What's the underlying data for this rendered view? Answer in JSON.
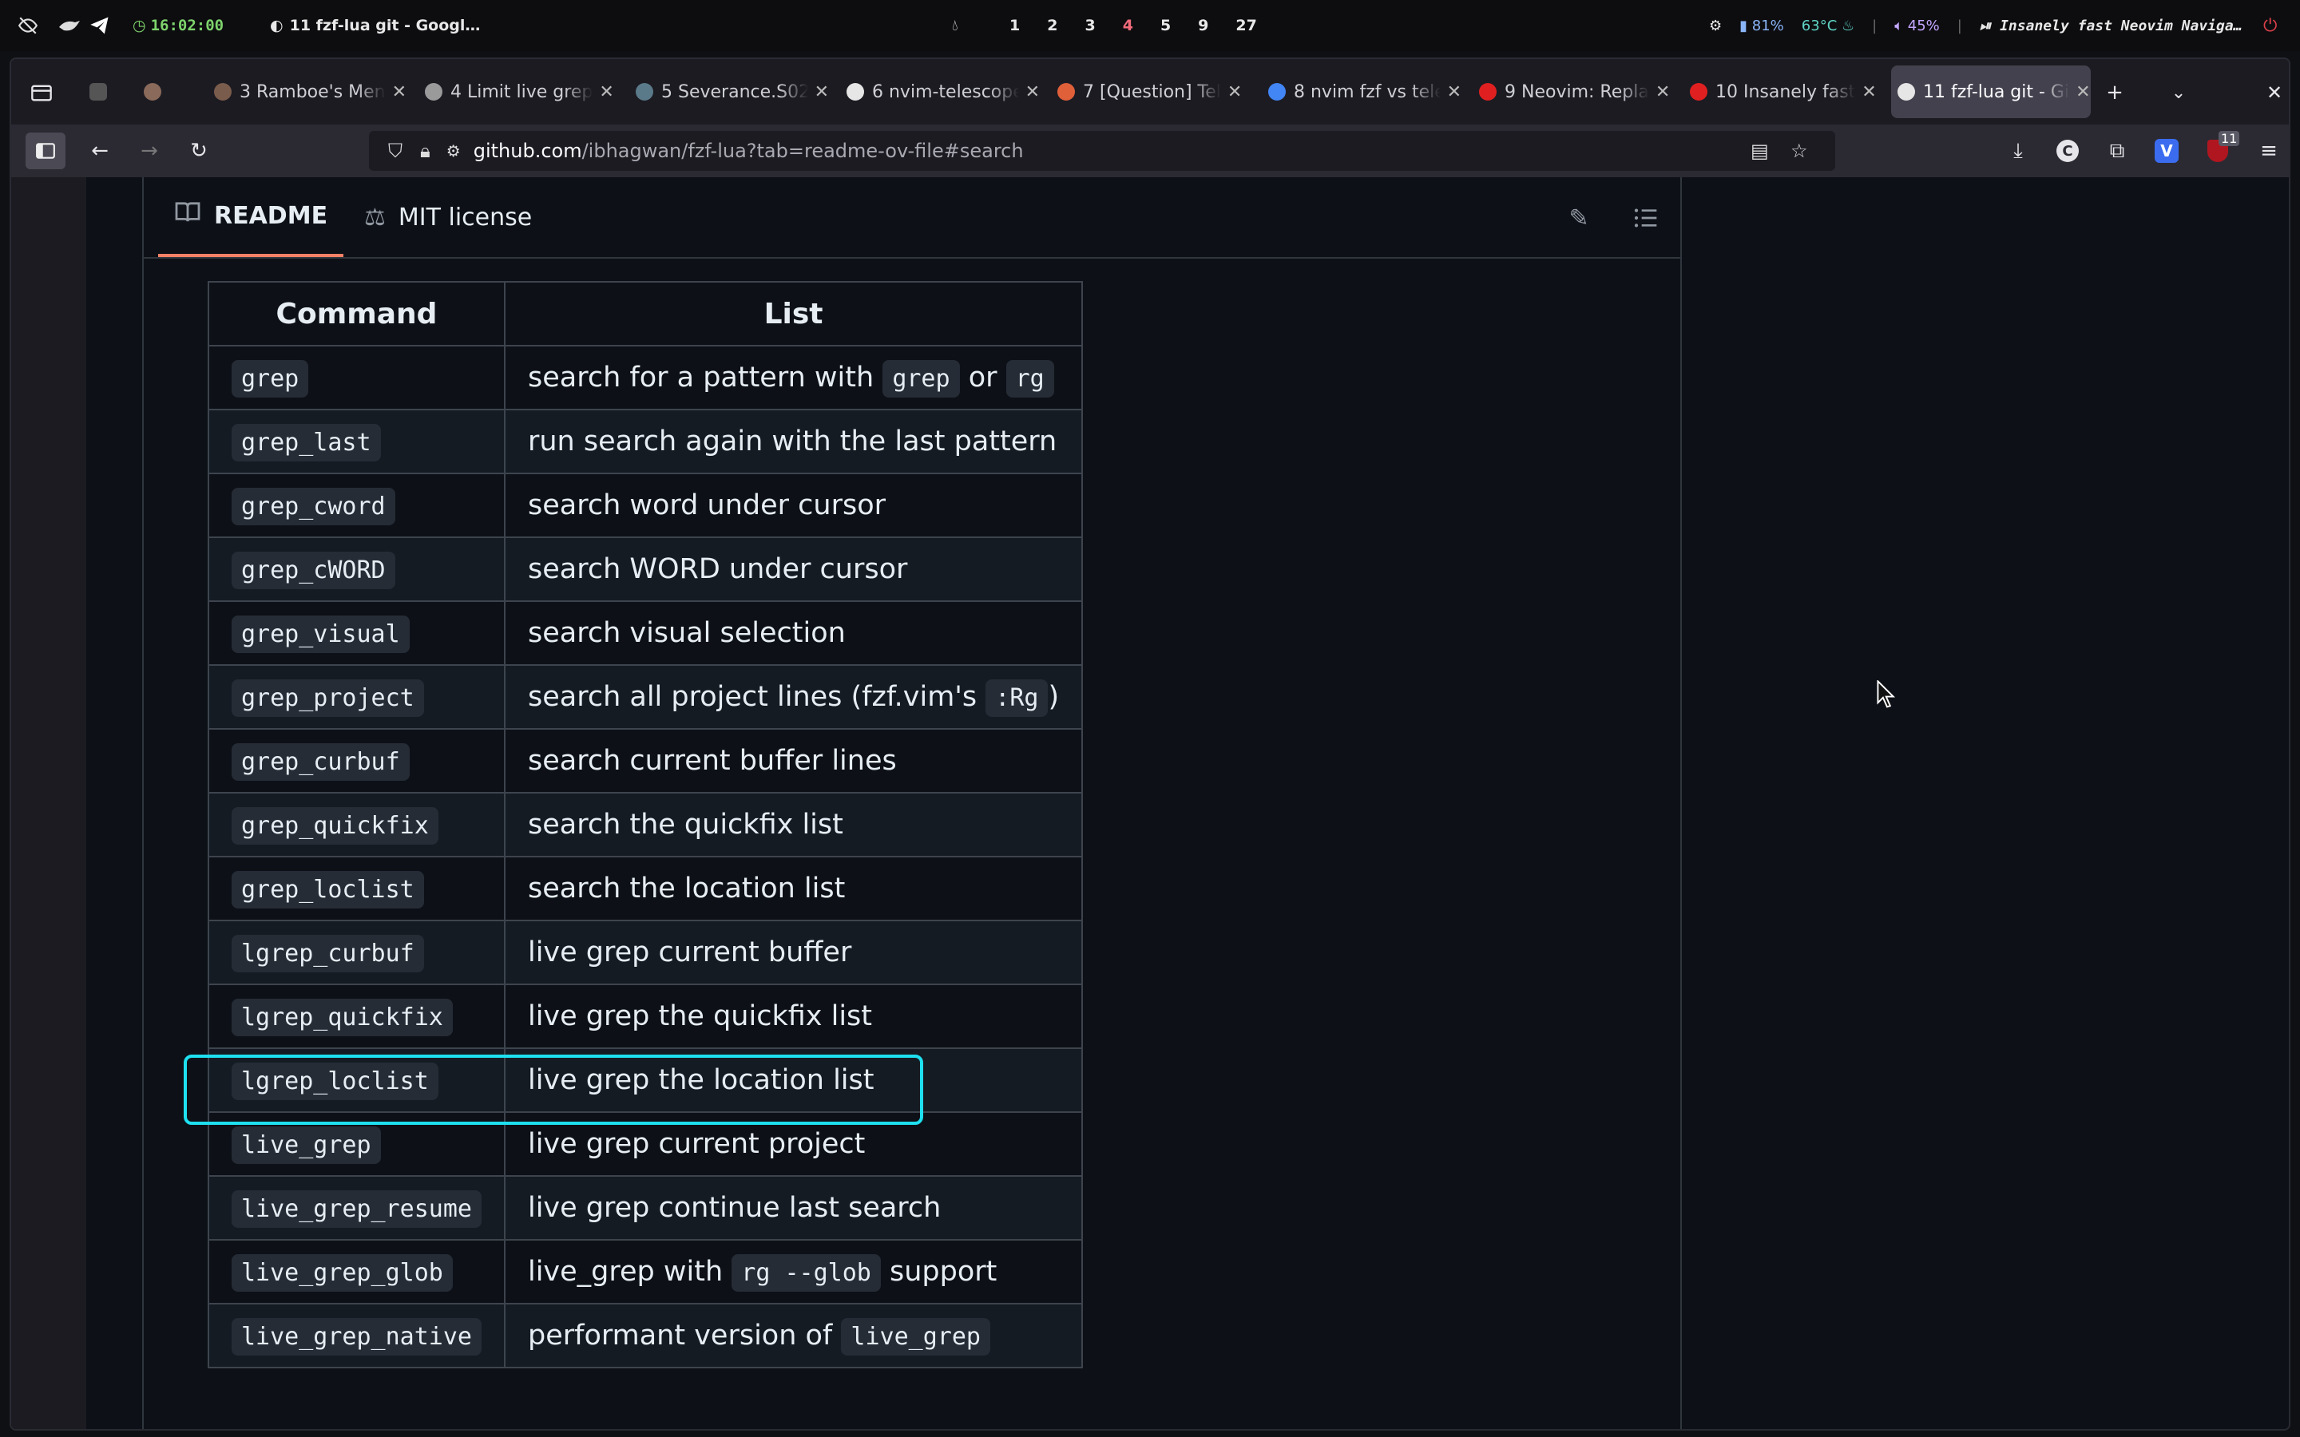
{
  "system_bar": {
    "clock": "16:02:00",
    "window_title": "11 fzf-lua git - Googl…",
    "workspaces": [
      {
        "label": "1",
        "alert": false
      },
      {
        "label": "2",
        "alert": false
      },
      {
        "label": "3",
        "alert": false
      },
      {
        "label": "4",
        "alert": true
      },
      {
        "label": "5",
        "alert": false
      },
      {
        "label": "9",
        "alert": false
      },
      {
        "label": "27",
        "alert": false
      }
    ],
    "battery": "81%",
    "temperature": "63°C",
    "volume": "45%",
    "media_title": "Insanely fast Neovim Naviga…"
  },
  "browser": {
    "tabs": [
      {
        "label": "3 Ramboe's Men",
        "favicon_color": "#7a5c4c",
        "active": false
      },
      {
        "label": "4 Limit live grep",
        "favicon_color": "#9a9a9a",
        "active": false
      },
      {
        "label": "5 Severance.S02",
        "favicon_color": "#5a7a8a",
        "active": false
      },
      {
        "label": "6 nvim-telescope",
        "favicon_color": "#e6e6e6",
        "active": false
      },
      {
        "label": "7 [Question] Tel",
        "favicon_color": "#e0603a",
        "active": false
      },
      {
        "label": "8 nvim fzf vs tele",
        "favicon_color": "#4285f4",
        "active": false
      },
      {
        "label": "9 Neovim: Repla",
        "favicon_color": "#e02020",
        "active": false
      },
      {
        "label": "10 Insanely fast",
        "favicon_color": "#e02020",
        "active": false
      },
      {
        "label": "11 fzf-lua git - Gi",
        "favicon_color": "#e6e6e6",
        "active": true
      }
    ],
    "url_host": "github.com",
    "url_path": "/ibhagwan/fzf-lua?tab=readme-ov-file#search",
    "extension_badge": "11"
  },
  "readme": {
    "tab_readme": "README",
    "tab_license": "MIT license",
    "table": {
      "headers": [
        "Command",
        "List"
      ],
      "rows": [
        {
          "cmd": "grep",
          "desc": [
            {
              "t": "search for a pattern with "
            },
            {
              "c": "grep"
            },
            {
              "t": " or "
            },
            {
              "c": "rg"
            }
          ]
        },
        {
          "cmd": "grep_last",
          "desc": [
            {
              "t": "run search again with the last pattern"
            }
          ]
        },
        {
          "cmd": "grep_cword",
          "desc": [
            {
              "t": "search word under cursor"
            }
          ]
        },
        {
          "cmd": "grep_cWORD",
          "desc": [
            {
              "t": "search WORD under cursor"
            }
          ]
        },
        {
          "cmd": "grep_visual",
          "desc": [
            {
              "t": "search visual selection"
            }
          ]
        },
        {
          "cmd": "grep_project",
          "desc": [
            {
              "t": "search all project lines (fzf.vim's "
            },
            {
              "c": ":Rg"
            },
            {
              "t": ")"
            }
          ]
        },
        {
          "cmd": "grep_curbuf",
          "desc": [
            {
              "t": "search current buffer lines"
            }
          ]
        },
        {
          "cmd": "grep_quickfix",
          "desc": [
            {
              "t": "search the quickfix list"
            }
          ]
        },
        {
          "cmd": "grep_loclist",
          "desc": [
            {
              "t": "search the location list"
            }
          ]
        },
        {
          "cmd": "lgrep_curbuf",
          "desc": [
            {
              "t": "live grep current buffer"
            }
          ]
        },
        {
          "cmd": "lgrep_quickfix",
          "desc": [
            {
              "t": "live grep the quickfix list"
            }
          ]
        },
        {
          "cmd": "lgrep_loclist",
          "desc": [
            {
              "t": "live grep the location list"
            }
          ]
        },
        {
          "cmd": "live_grep",
          "desc": [
            {
              "t": "live grep current project"
            }
          ]
        },
        {
          "cmd": "live_grep_resume",
          "desc": [
            {
              "t": "live grep continue last search"
            }
          ]
        },
        {
          "cmd": "live_grep_glob",
          "desc": [
            {
              "t": "live_grep with "
            },
            {
              "c": "rg --glob"
            },
            {
              "t": " support"
            }
          ]
        },
        {
          "cmd": "live_grep_native",
          "desc": [
            {
              "t": "performant version of "
            },
            {
              "c": "live_grep"
            }
          ]
        }
      ]
    }
  },
  "colors": {
    "highlight_border": "#1ee0f0",
    "tab_underline": "#f78166"
  }
}
